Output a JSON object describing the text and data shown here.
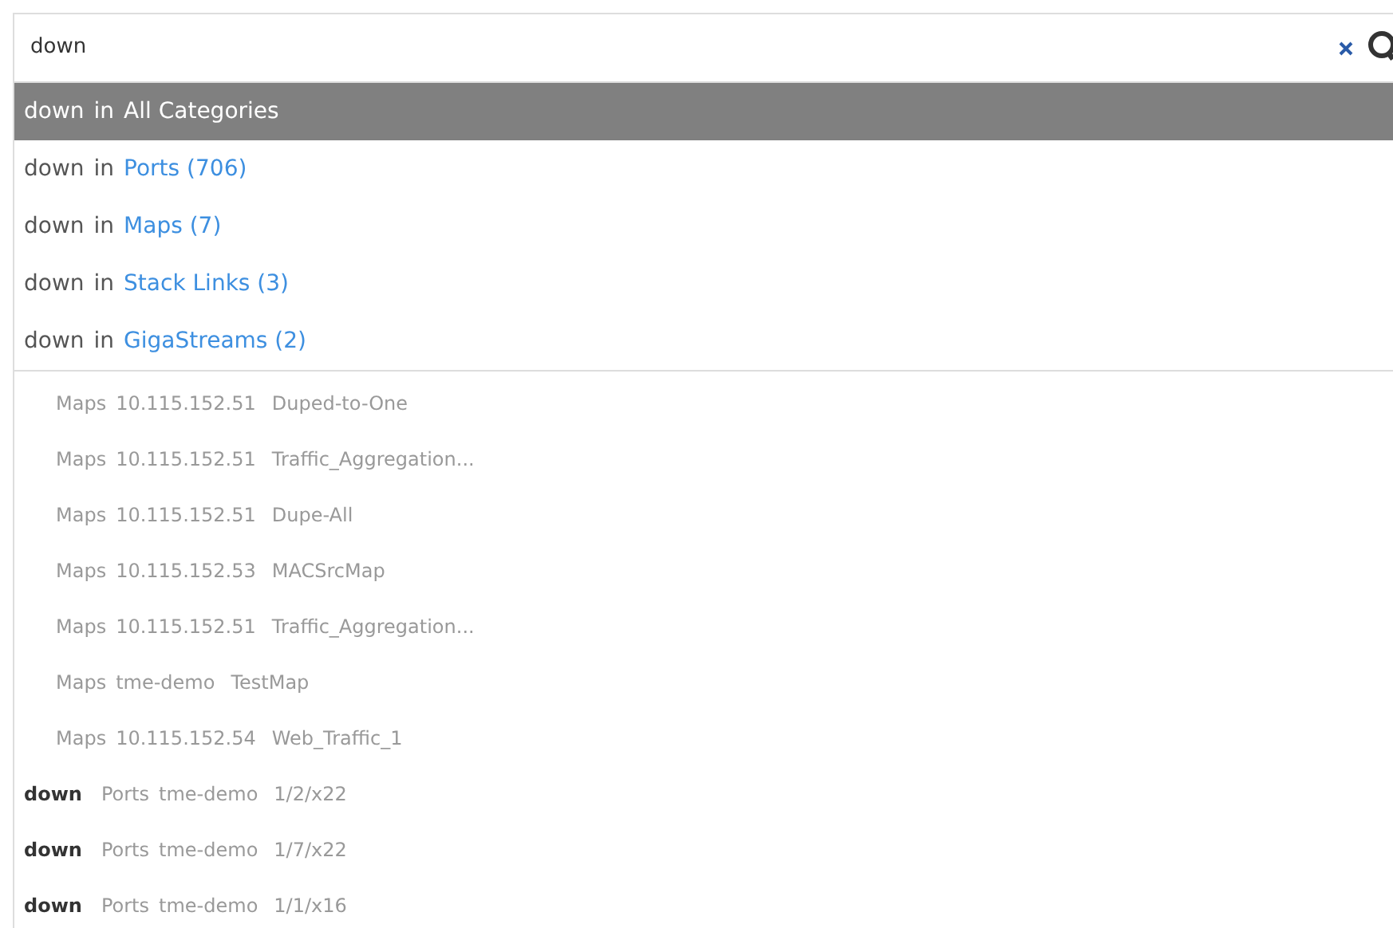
{
  "search": {
    "value": "down"
  },
  "suggestions": [
    {
      "query": "down",
      "connector": "in",
      "category": "All Categories",
      "selected": true
    },
    {
      "query": "down",
      "connector": "in",
      "category": "Ports (706)",
      "selected": false
    },
    {
      "query": "down",
      "connector": "in",
      "category": "Maps (7)",
      "selected": false
    },
    {
      "query": "down",
      "connector": "in",
      "category": "Stack Links (3)",
      "selected": false
    },
    {
      "query": "down",
      "connector": "in",
      "category": "GigaStreams (2)",
      "selected": false
    }
  ],
  "results": [
    {
      "kind": "map",
      "parts": [
        "Maps",
        "10.115.152.51",
        "Duped-to-One"
      ]
    },
    {
      "kind": "map",
      "parts": [
        "Maps",
        "10.115.152.51",
        "Traffic_Aggregation..."
      ]
    },
    {
      "kind": "map",
      "parts": [
        "Maps",
        "10.115.152.51",
        "Dupe-All"
      ]
    },
    {
      "kind": "map",
      "parts": [
        "Maps",
        "10.115.152.53",
        "MACSrcMap"
      ]
    },
    {
      "kind": "map",
      "parts": [
        "Maps",
        "10.115.152.51",
        "Traffic_Aggregation..."
      ]
    },
    {
      "kind": "map",
      "parts": [
        "Maps",
        "tme-demo",
        "TestMap"
      ]
    },
    {
      "kind": "map",
      "parts": [
        "Maps",
        "10.115.152.54",
        "Web_Traffic_1"
      ]
    },
    {
      "kind": "port",
      "status": "down",
      "parts": [
        "Ports",
        "tme-demo",
        "1/2/x22"
      ]
    },
    {
      "kind": "port",
      "status": "down",
      "parts": [
        "Ports",
        "tme-demo",
        "1/7/x22"
      ]
    },
    {
      "kind": "port",
      "status": "down",
      "parts": [
        "Ports",
        "tme-demo",
        "1/1/x16"
      ]
    }
  ]
}
